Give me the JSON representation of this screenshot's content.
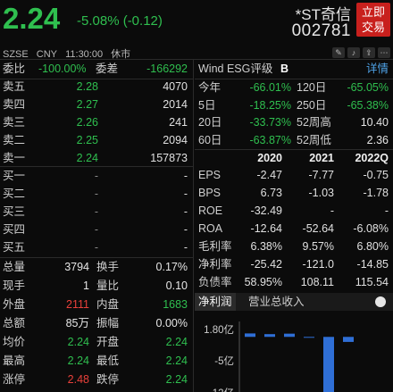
{
  "header": {
    "price": "2.24",
    "change": "-5.08% (-0.12)",
    "name": "*ST奇信",
    "code": "002781",
    "trade_button": [
      "立即",
      "交易"
    ],
    "meta": [
      "SZSE",
      "CNY",
      "11:30:00",
      "休市"
    ],
    "icons": [
      "edit-icon",
      "bell-icon",
      "share-icon",
      "more-icon"
    ]
  },
  "book": {
    "weibi_label": "委比",
    "weibi_value": "-100.00%",
    "weicha_label": "委差",
    "weicha_value": "-166292",
    "asks": [
      {
        "label": "卖五",
        "price": "2.28",
        "volume": "4070"
      },
      {
        "label": "卖四",
        "price": "2.27",
        "volume": "2014"
      },
      {
        "label": "卖三",
        "price": "2.26",
        "volume": "241"
      },
      {
        "label": "卖二",
        "price": "2.25",
        "volume": "2094"
      },
      {
        "label": "卖一",
        "price": "2.24",
        "volume": "157873"
      }
    ],
    "bids": [
      {
        "label": "买一",
        "price": "-",
        "volume": "-"
      },
      {
        "label": "买二",
        "price": "-",
        "volume": "-"
      },
      {
        "label": "买三",
        "price": "-",
        "volume": "-"
      },
      {
        "label": "买四",
        "price": "-",
        "volume": "-"
      },
      {
        "label": "买五",
        "price": "-",
        "volume": "-"
      }
    ]
  },
  "stats": [
    {
      "l1": "总量",
      "v1": "3794",
      "c1": "white",
      "l2": "换手",
      "v2": "0.17%",
      "c2": "white"
    },
    {
      "l1": "现手",
      "v1": "1",
      "c1": "white",
      "l2": "量比",
      "v2": "0.10",
      "c2": "white"
    },
    {
      "l1": "外盘",
      "v1": "2111",
      "c1": "red",
      "l2": "内盘",
      "v2": "1683",
      "c2": "green"
    },
    {
      "l1": "总额",
      "v1": "85万",
      "c1": "white",
      "l2": "振幅",
      "v2": "0.00%",
      "c2": "white"
    },
    {
      "l1": "均价",
      "v1": "2.24",
      "c1": "green",
      "l2": "开盘",
      "v2": "2.24",
      "c2": "green"
    },
    {
      "l1": "最高",
      "v1": "2.24",
      "c1": "green",
      "l2": "最低",
      "v2": "2.24",
      "c2": "green"
    },
    {
      "l1": "涨停",
      "v1": "2.48",
      "c1": "red",
      "l2": "跌停",
      "v2": "2.24",
      "c2": "green"
    }
  ],
  "esg": {
    "label": "Wind  ESG评级",
    "grade": "B",
    "detail": "详情"
  },
  "performance": [
    {
      "l1": "今年",
      "v1": "-66.01%",
      "c1": "green",
      "l2": "120日",
      "v2": "-65.05%",
      "c2": "green"
    },
    {
      "l1": "5日",
      "v1": "-18.25%",
      "c1": "green",
      "l2": "250日",
      "v2": "-65.38%",
      "c2": "green"
    },
    {
      "l1": "20日",
      "v1": "-33.73%",
      "c1": "green",
      "l2": "52周高",
      "v2": "10.40",
      "c2": "white"
    },
    {
      "l1": "60日",
      "v1": "-63.87%",
      "c1": "green",
      "l2": "52周低",
      "v2": "2.36",
      "c2": "white"
    }
  ],
  "financials": {
    "headers": [
      "",
      "2020",
      "2021",
      "2022Q"
    ],
    "rows": [
      [
        "EPS",
        "-2.47",
        "-7.77",
        "-0.75"
      ],
      [
        "BPS",
        "6.73",
        "-1.03",
        "-1.78"
      ],
      [
        "ROE",
        "-32.49",
        "-",
        "-"
      ],
      [
        "ROA",
        "-12.64",
        "-52.64",
        "-6.08%"
      ],
      [
        "毛利率",
        "6.38%",
        "9.57%",
        "6.80%"
      ],
      [
        "净利率",
        "-25.42",
        "-121.0",
        "-14.85"
      ],
      [
        "负债率",
        "58.95%",
        "108.11",
        "115.54"
      ]
    ]
  },
  "tabs": [
    {
      "label": "净利润",
      "active": true
    },
    {
      "label": "营业总收入",
      "active": false
    }
  ],
  "chart_data": {
    "type": "bar",
    "yticks": [
      "1.80亿",
      "-5亿",
      "-12亿"
    ],
    "ytick_values": [
      1.8,
      -5,
      -12
    ],
    "ylim": [
      -12,
      1.8
    ],
    "series": [
      {
        "values": [
          0.75,
          0.6,
          0.7,
          -0.1,
          -12,
          -1.1
        ],
        "colors": [
          "#2f6fd6",
          "#2f6fd6",
          "#2f6fd6",
          "#2f6fd6",
          "#2f6fd6",
          "#2f6fd6"
        ]
      }
    ]
  }
}
